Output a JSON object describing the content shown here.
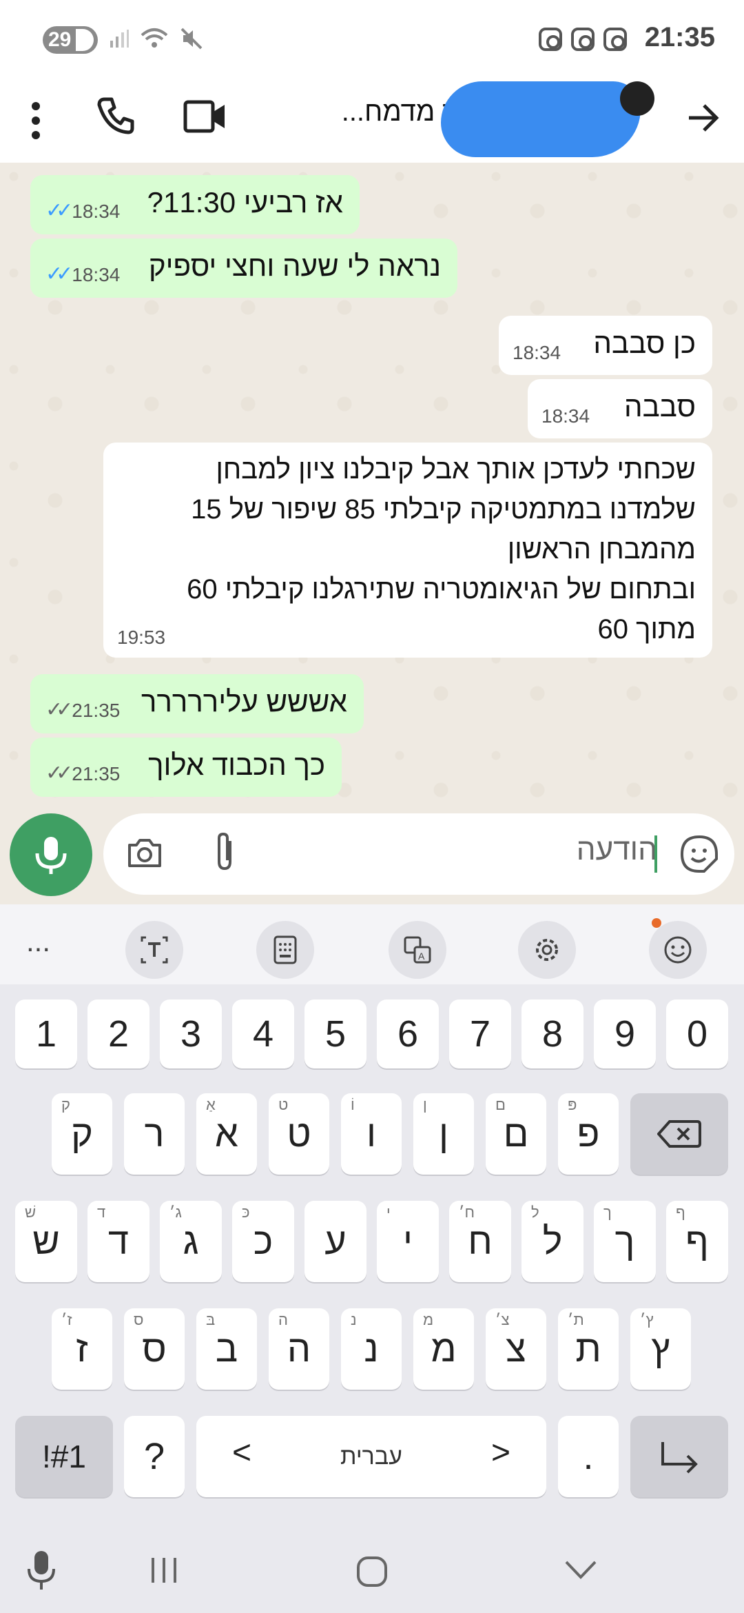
{
  "status_bar": {
    "battery": "29",
    "time": "21:35"
  },
  "header": {
    "contact_title": "ש תלמיד מדמח..."
  },
  "messages": [
    {
      "text": "אז רביעי 11:30?",
      "time": "18:34",
      "direction": "sent",
      "status": "read"
    },
    {
      "text": "נראה לי שעה וחצי יספיק",
      "time": "18:34",
      "direction": "sent",
      "status": "read"
    },
    {
      "text": "כן סבבה",
      "time": "18:34",
      "direction": "received"
    },
    {
      "text": "סבבה",
      "time": "18:34",
      "direction": "received"
    },
    {
      "lines": [
        "שכחתי לעדכן אותך אבל קיבלנו ציון למבחן",
        "שלמדנו במתמטיקה קיבלתי 85 שיפור של 15",
        "מהמבחן הראשון",
        "ובתחום של הגיאומטריה שתירגלנו קיבלתי 60",
        "מתוך 60"
      ],
      "time": "19:53",
      "direction": "received"
    },
    {
      "text": "אששש עליררררר",
      "time": "21:35",
      "direction": "sent",
      "status": "delivered"
    },
    {
      "text": "כך הכבוד אלוך",
      "time": "21:35",
      "direction": "sent",
      "status": "delivered"
    }
  ],
  "input": {
    "text": "הודעה"
  },
  "keyboard": {
    "number_row": [
      "1",
      "2",
      "3",
      "4",
      "5",
      "6",
      "7",
      "8",
      "9",
      "0"
    ],
    "row1": [
      {
        "key": "ק",
        "hint": "ק"
      },
      {
        "key": "ר",
        "hint": ""
      },
      {
        "key": "א",
        "hint": "אַ"
      },
      {
        "key": "ט",
        "hint": "ט"
      },
      {
        "key": "ו",
        "hint": "וֹ"
      },
      {
        "key": "ן",
        "hint": "ן"
      },
      {
        "key": "ם",
        "hint": "ם"
      },
      {
        "key": "פ",
        "hint": "פּ"
      }
    ],
    "row2": [
      {
        "key": "ש",
        "hint": "שׁ"
      },
      {
        "key": "ד",
        "hint": "ד"
      },
      {
        "key": "ג",
        "hint": "ג׳"
      },
      {
        "key": "כ",
        "hint": "כּ"
      },
      {
        "key": "ע",
        "hint": ""
      },
      {
        "key": "י",
        "hint": "י"
      },
      {
        "key": "ח",
        "hint": "ח׳"
      },
      {
        "key": "ל",
        "hint": "ל"
      },
      {
        "key": "ך",
        "hint": "ך"
      },
      {
        "key": "ף",
        "hint": "ף"
      }
    ],
    "row3": [
      {
        "key": "ז",
        "hint": "ז׳"
      },
      {
        "key": "ס",
        "hint": "ס"
      },
      {
        "key": "ב",
        "hint": "בּ"
      },
      {
        "key": "ה",
        "hint": "ה"
      },
      {
        "key": "נ",
        "hint": "נ"
      },
      {
        "key": "מ",
        "hint": "מ"
      },
      {
        "key": "צ",
        "hint": "צ׳"
      },
      {
        "key": "ת",
        "hint": "ת׳"
      },
      {
        "key": "ץ",
        "hint": "ץ׳"
      }
    ],
    "symbols_label": "!#1",
    "question_label": "?",
    "space_label": "עברית",
    "space_left": "<",
    "space_right": ">",
    "period_label": ".",
    "toolbar_more": "..."
  },
  "colors": {
    "accent_green": "#3f9f63",
    "sent_bubble": "#d9fdd3",
    "read_tick": "#3b9bff"
  }
}
